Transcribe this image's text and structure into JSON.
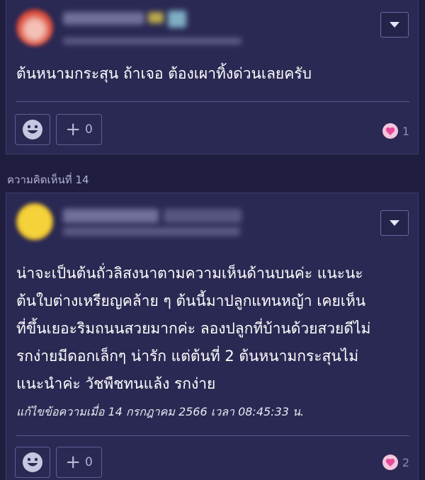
{
  "comment_prev": {
    "text": "ต้นหนามกระสุน ถ้าเจอ ต้องเผาทิ้งด่วนเลยครับ",
    "plus_count": "0",
    "heart_count": "1",
    "icons": {
      "menu": "dropdown-triangle-icon",
      "emoji": "smiley-icon",
      "plus": "plus-icon",
      "heart": "heart-icon"
    }
  },
  "section_label": "ความคิดเห็นที่ 14",
  "comment_14": {
    "text": "น่าจะเป็นต้นถั่วลิสงนาตามความเห็นด้านบนค่ะ แนะนะ\nต้นใบต่างเหรียญคล้าย ๆ ต้นนี้มาปลูกแทนหญ้า เคยเห็น\nที่ขึ้นเยอะริมถนนสวยมากค่ะ ลองปลูกที่บ้านด้วยสวยดีไม่\nรกง่ายมีดอกเล็กๆ น่ารัก แต่ต้นที่ 2 ต้นหนามกระสุนไม่\nแนะนำค่ะ วัชพืชทนแล้ง รกง่าย",
    "edit_note": "แก้ไขข้อความเมื่อ 14 กรกฎาคม 2566 เวลา 08:45:33 น.",
    "plus_count": "0",
    "heart_count": "2"
  },
  "colors": {
    "background": "#1f1e3e",
    "card": "#2a2953",
    "border": "#3e3d6e",
    "text": "#ffffff",
    "heart": "#f07ab6"
  }
}
